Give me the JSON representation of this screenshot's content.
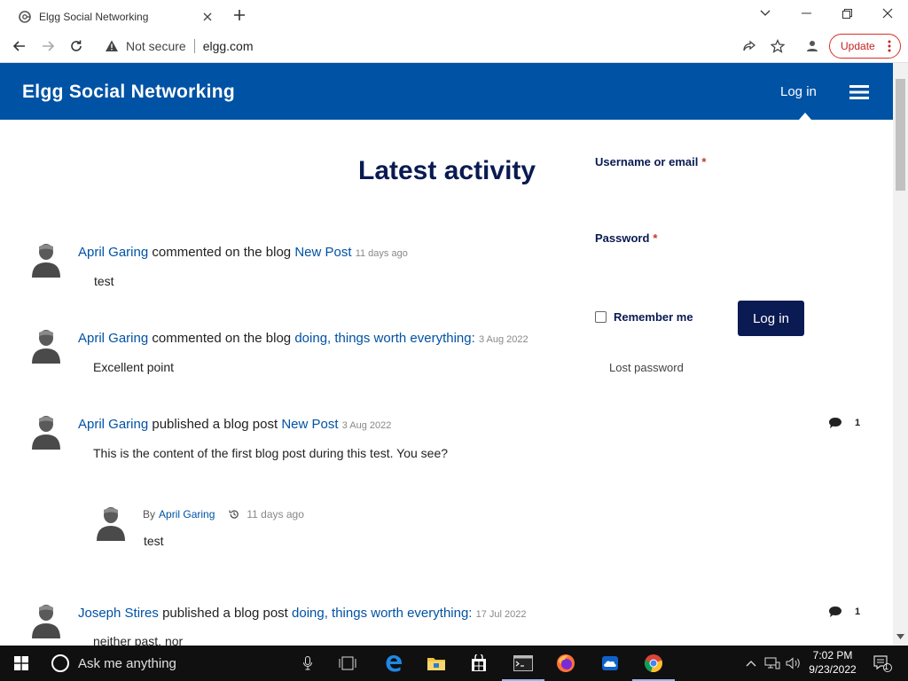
{
  "browser": {
    "tab_title": "Elgg Social Networking",
    "not_secure": "Not secure",
    "url": "elgg.com",
    "update_label": "Update"
  },
  "site": {
    "title": "Elgg Social Networking",
    "login_link": "Log in"
  },
  "main": {
    "heading": "Latest activity",
    "activities": [
      {
        "actor": "April Garing",
        "verb": "commented on the blog",
        "target": "New Post",
        "time": "11 days ago",
        "body": "test"
      },
      {
        "actor": "April Garing",
        "verb": "commented on the blog",
        "target": "doing, things worth everything:",
        "time": "3 Aug 2022",
        "body": "Excellent point"
      },
      {
        "actor": "April Garing",
        "verb": "published a blog post",
        "target": "New Post",
        "time": "3 Aug 2022",
        "body": "This is the content of the  first blog post during this test.  You see?",
        "comments": "1",
        "sub_comment": {
          "by_prefix": "By",
          "author": "April Garing",
          "time": "11 days ago",
          "body": "test"
        }
      },
      {
        "actor": "Joseph Stires",
        "verb": "published a blog post",
        "target": "doing, things worth everything:",
        "time": "17 Jul 2022",
        "body": "neither past, nor",
        "comments": "1"
      }
    ]
  },
  "login": {
    "username_label": "Username or email",
    "password_label": "Password",
    "required_mark": "*",
    "remember_label": "Remember me",
    "submit_label": "Log in",
    "lost_password": "Lost password"
  },
  "taskbar": {
    "search_placeholder": "Ask me anything",
    "time": "7:02 PM",
    "date": "9/23/2022",
    "notification_count": "1"
  },
  "colors": {
    "header_bg": "#0052a5",
    "heading": "#0a1a52",
    "link": "#0052a5",
    "login_button": "#0a1a52",
    "required": "#c0392b"
  }
}
